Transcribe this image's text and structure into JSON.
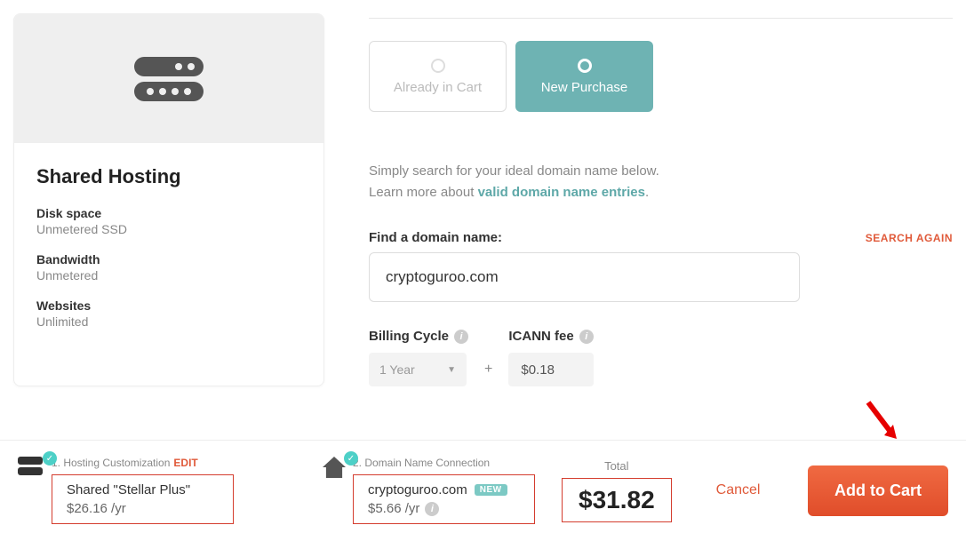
{
  "card": {
    "title": "Shared Hosting",
    "specs": [
      {
        "label": "Disk space",
        "value": "Unmetered SSD"
      },
      {
        "label": "Bandwidth",
        "value": "Unmetered"
      },
      {
        "label": "Websites",
        "value": "Unlimited"
      }
    ]
  },
  "toggles": {
    "already": "Already in Cart",
    "new": "New Purchase"
  },
  "desc": {
    "line1": "Simply search for your ideal domain name below.",
    "line2_prefix": "Learn more about ",
    "link": "valid domain name entries",
    "line2_suffix": "."
  },
  "domain": {
    "label": "Find a domain name:",
    "search_again": "SEARCH AGAIN",
    "value": "cryptoguroo.com"
  },
  "billing": {
    "cycle_label": "Billing Cycle",
    "cycle_value": "1 Year",
    "plus": "+",
    "icann_label": "ICANN fee",
    "icann_value": "$0.18"
  },
  "footer": {
    "step1": {
      "num": "1. Hosting Customization",
      "edit": "EDIT",
      "name": "Shared \"Stellar Plus\"",
      "price": "$26.16 /yr"
    },
    "step2": {
      "num": "2. Domain Name Connection",
      "name": "cryptoguroo.com",
      "badge": "NEW",
      "price": "$5.66 /yr"
    },
    "total_label": "Total",
    "total": "$31.82",
    "cancel": "Cancel",
    "add": "Add to Cart"
  }
}
